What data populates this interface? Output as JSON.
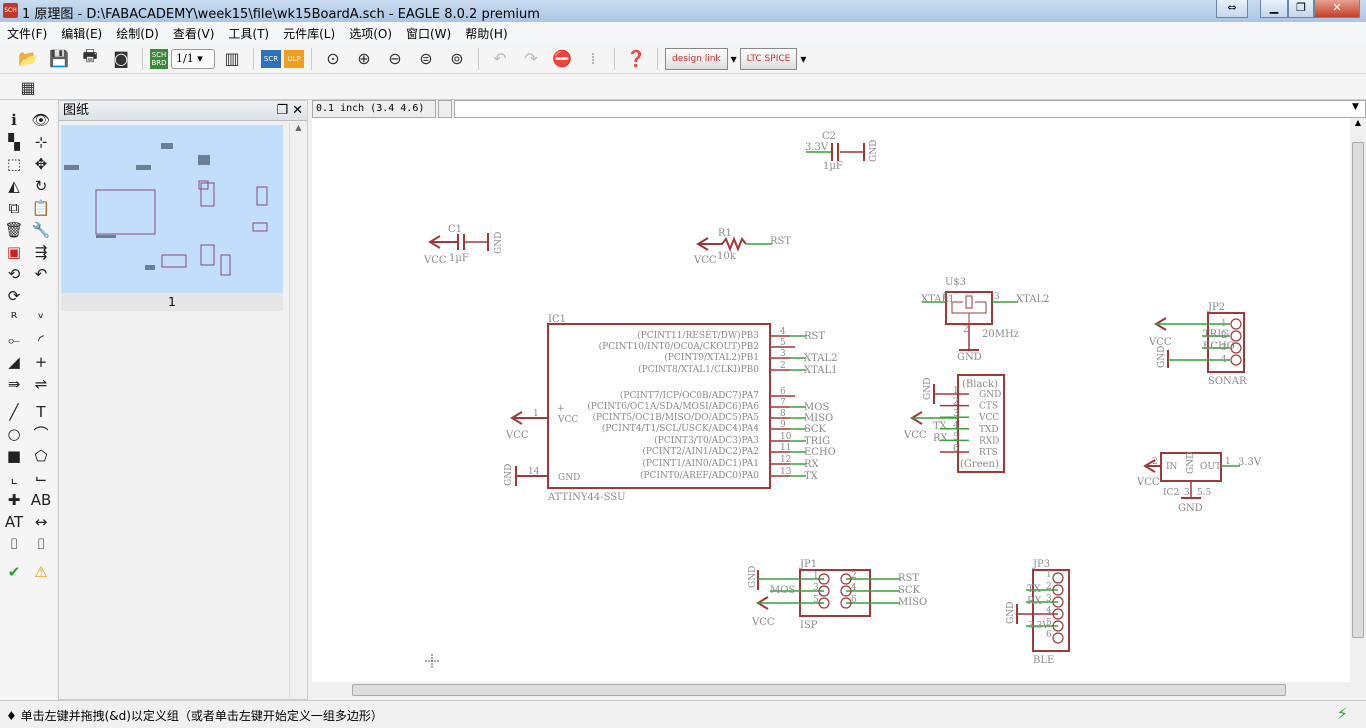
{
  "window": {
    "title": "1 原理图 - D:\\FABACADEMY\\week15\\file\\wk15BoardA.sch - EAGLE 8.0.2 premium",
    "app_icon": "SCH"
  },
  "menu": [
    "文件(F)",
    "编辑(E)",
    "绘制(D)",
    "查看(V)",
    "工具(T)",
    "元件库(L)",
    "选项(O)",
    "窗口(W)",
    "帮助(H)"
  ],
  "toolbar": {
    "sheet_select": "1/1",
    "design_link": "design link",
    "ltspice": "LTC SPICE",
    "sch_brd": "SCH BRD",
    "scr": "SCR",
    "ulp": "ULP"
  },
  "panel": {
    "title": "图纸",
    "sheet_label": "1"
  },
  "coordinate": "0.1 inch (3.4 4.6)",
  "command_input": "",
  "status": "♦ 单击左键并拖拽(&d)以定义组（或者单击左键开始定义一组多边形）",
  "colors": {
    "part": "#9e3a3a",
    "net": "#3aa03a",
    "text": "#8a8a8a",
    "thumbnail": "#c2defa"
  },
  "schematic": {
    "c2": {
      "name": "C2",
      "value": "1µF",
      "left": "3.3V",
      "right": "GND"
    },
    "c1": {
      "name": "C1",
      "value": "1µF",
      "left": "VCC",
      "right": "GND"
    },
    "r1": {
      "name": "R1",
      "value": "10k",
      "left": "VCC",
      "right": "RST"
    },
    "ic1": {
      "name": "IC1",
      "value": "ATTINY44-SSU",
      "left_pins": [
        {
          "num": "1",
          "name": "VCC",
          "net": "VCC",
          "sym": "+"
        },
        {
          "num": "14",
          "name": "GND",
          "net": "GND"
        }
      ],
      "right_pins": [
        {
          "name": "(PCINT11/RESET/DW)PB3",
          "num": "4",
          "net": "RST"
        },
        {
          "name": "(PCINT10/INT0/OC0A/CKOUT)PB2",
          "num": "5",
          "net": ""
        },
        {
          "name": "(PCINT9/XTAL2)PB1",
          "num": "3",
          "net": "XTAL2"
        },
        {
          "name": "(PCINT8/XTAL1/CLKI)PB0",
          "num": "2",
          "net": "XTAL1"
        },
        {
          "name": "(PCINT7/ICP/OC0B/ADC7)PA7",
          "num": "6",
          "net": ""
        },
        {
          "name": "(PCINT6/OC1A/SDA/MOSI/ADC6)PA6",
          "num": "7",
          "net": "MOS"
        },
        {
          "name": "(PCINT5/OC1B/MISO/DO/ADC5)PA5",
          "num": "8",
          "net": "MISO"
        },
        {
          "name": "(PCINT4/T1/SCL/USCK/ADC4)PA4",
          "num": "9",
          "net": "SCK"
        },
        {
          "name": "(PCINT3/T0/ADC3)PA3",
          "num": "10",
          "net": "TRIG"
        },
        {
          "name": "(PCINT2/AIN1/ADC2)PA2",
          "num": "11",
          "net": "ECHO"
        },
        {
          "name": "(PCINT1/AIN0/ADC1)PA1",
          "num": "12",
          "net": "RX"
        },
        {
          "name": "(PCINT0/AREF/ADC0)PA0",
          "num": "13",
          "net": "TX"
        }
      ]
    },
    "u3": {
      "name": "U$3",
      "value": "20MHz",
      "left": "XTAL1",
      "right": "XTAL2",
      "pin1": "1",
      "pin2": "2",
      "pin3": "3",
      "gnd": "GND"
    },
    "ftdi": {
      "top": "(Black)",
      "bottom": "(Green)",
      "pins": [
        {
          "num": "1",
          "name": "GND"
        },
        {
          "num": "2",
          "name": "CTS"
        },
        {
          "num": "3",
          "name": "VCC"
        },
        {
          "num": "4",
          "name": "TXD"
        },
        {
          "num": "5",
          "name": "RXD"
        },
        {
          "num": "6",
          "name": "RTS"
        }
      ],
      "gnd": "GND",
      "vcc": "VCC",
      "tx": "TX",
      "rx": "RX"
    },
    "jp2": {
      "name": "JP2",
      "value": "SONAR",
      "pins": [
        "1",
        "2",
        "3",
        "4"
      ],
      "vcc": "VCC",
      "trig": "TRIG",
      "echo": "ECHO",
      "gnd": "GND"
    },
    "ic2": {
      "name": "IC2",
      "value": "5.5",
      "in": "IN",
      "out": "OUT",
      "gnd_pin": "GND",
      "pin_in": "2",
      "pin_out": "1",
      "pin_gnd": "3",
      "out_net": "3.3V",
      "in_net": "VCC",
      "gnd": "GND"
    },
    "jp1": {
      "name": "JP1",
      "value": "ISP",
      "pins": [
        "1",
        "2",
        "3",
        "4",
        "5",
        "6"
      ],
      "gnd": "GND",
      "mos": "MOS",
      "vcc": "VCC",
      "rst": "RST",
      "sck": "SCK",
      "miso": "MISO"
    },
    "jp3": {
      "name": "JP3",
      "value": "BLE",
      "pins": [
        "1",
        "2",
        "3",
        "4",
        "5",
        "6"
      ],
      "tx": "TX",
      "rx": "RX",
      "gnd": "GND",
      "v33": "3.3V"
    }
  }
}
